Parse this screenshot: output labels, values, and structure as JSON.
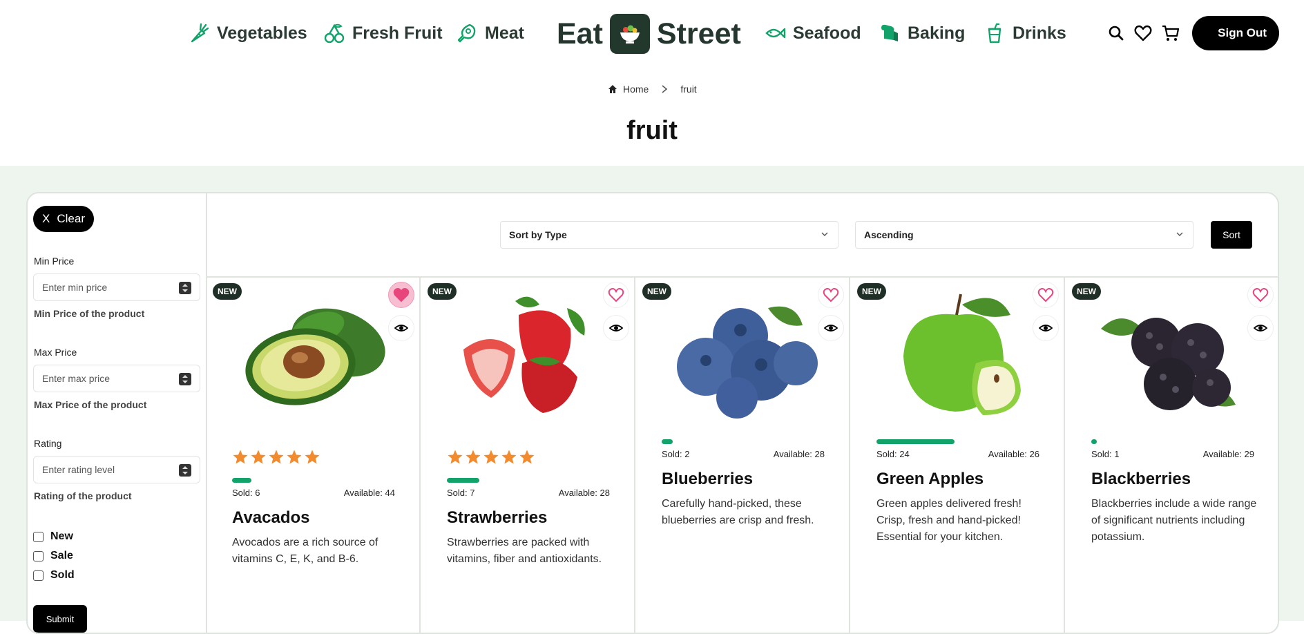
{
  "header": {
    "nav_left": [
      {
        "label": "Vegetables",
        "icon": "carrot-icon"
      },
      {
        "label": "Fresh Fruit",
        "icon": "cherries-icon"
      },
      {
        "label": "Meat",
        "icon": "meat-icon"
      }
    ],
    "logo_left": "Eat",
    "logo_right": "Street",
    "nav_right": [
      {
        "label": "Seafood",
        "icon": "fish-icon"
      },
      {
        "label": "Baking",
        "icon": "bread-icon"
      },
      {
        "label": "Drinks",
        "icon": "cup-icon"
      }
    ],
    "signout_label": "Sign Out"
  },
  "breadcrumb": {
    "home": "Home",
    "current": "fruit"
  },
  "page_title": "fruit",
  "filters": {
    "clear_icon": "X",
    "clear_label": "Clear",
    "min_price": {
      "label": "Min Price",
      "placeholder": "Enter min price",
      "help": "Min Price of the product"
    },
    "max_price": {
      "label": "Max Price",
      "placeholder": "Enter max price",
      "help": "Max Price of the product"
    },
    "rating": {
      "label": "Rating",
      "placeholder": "Enter rating level",
      "help": "Rating of the product"
    },
    "checkboxes": [
      "New",
      "Sale",
      "Sold"
    ],
    "submit_label": "Submit"
  },
  "sort": {
    "type_value": "Sort by Type",
    "order_value": "Ascending",
    "button_label": "Sort"
  },
  "colors": {
    "accent": "#12a36a",
    "star": "#f28a2e",
    "heart": "#e8457c",
    "dark": "#1f2e26"
  },
  "products": [
    {
      "badge": "NEW",
      "favorited": true,
      "rating": 5,
      "sold_label": "Sold: 6",
      "available_label": "Available: 44",
      "sold_fraction": 0.12,
      "name": "Avacados",
      "description": "Avocados are a rich source of vitamins C, E, K, and B-6."
    },
    {
      "badge": "NEW",
      "favorited": false,
      "rating": 5,
      "sold_label": "Sold: 7",
      "available_label": "Available: 28",
      "sold_fraction": 0.2,
      "name": "Strawberries",
      "description": "Strawberries are packed with vitamins, fiber and antioxidants."
    },
    {
      "badge": "NEW",
      "favorited": false,
      "rating": 0,
      "sold_label": "Sold: 2",
      "available_label": "Available: 28",
      "sold_fraction": 0.067,
      "name": "Blueberries",
      "description": "Carefully hand-picked, these blueberries are crisp and fresh."
    },
    {
      "badge": "NEW",
      "favorited": false,
      "rating": 0,
      "sold_label": "Sold: 24",
      "available_label": "Available: 26",
      "sold_fraction": 0.48,
      "name": "Green Apples",
      "description": "Green apples delivered fresh! Crisp, fresh and hand-picked! Essential for your kitchen."
    },
    {
      "badge": "NEW",
      "favorited": false,
      "rating": 0,
      "sold_label": "Sold: 1",
      "available_label": "Available: 29",
      "sold_fraction": 0.033,
      "name": "Blackberries",
      "description": "Blackberries include a wide range of significant nutrients including potassium."
    }
  ]
}
